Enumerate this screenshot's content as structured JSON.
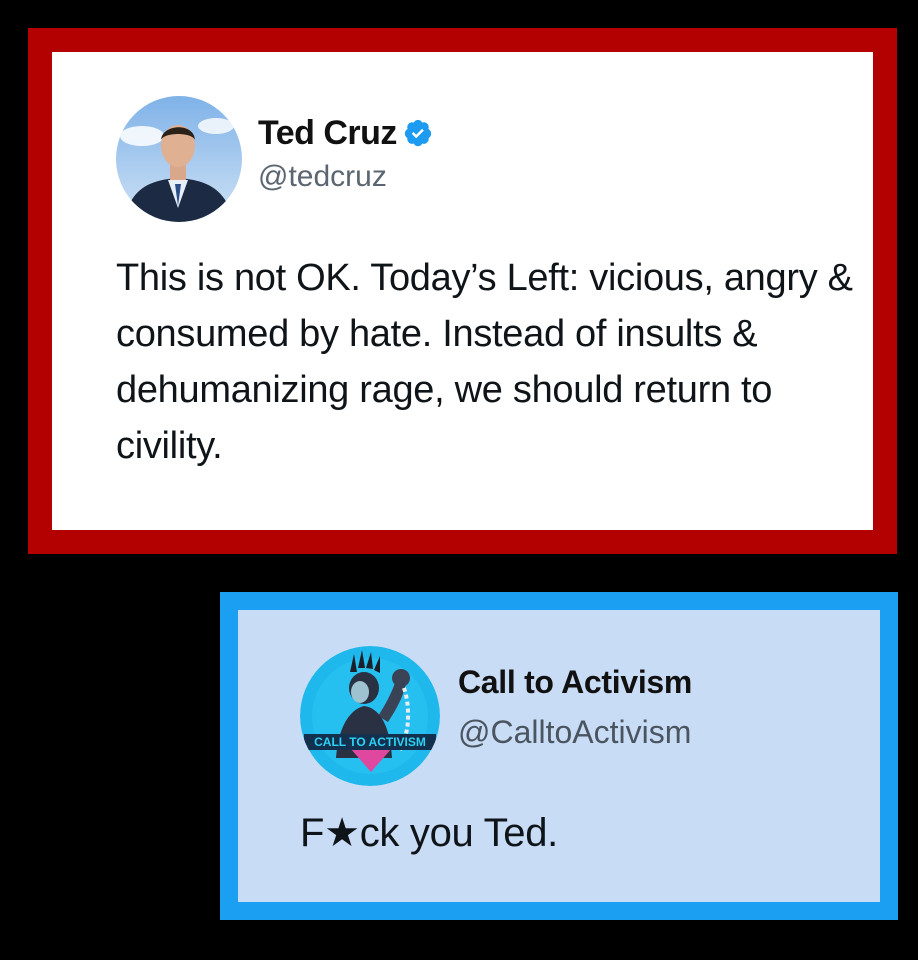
{
  "tweet1": {
    "author_name": "Ted Cruz",
    "handle": "@tedcruz",
    "text": "This is not OK. Today’s Left: vicious, angry & consumed by hate. Instead of insults & dehumanizing rage, we should return to civility.",
    "verified_icon": "verified-badge-icon",
    "frame_color": "#b30000"
  },
  "tweet2": {
    "author_name": "Call to Activism",
    "handle": "@CalltoActivism",
    "text": "F★ck you Ted.",
    "avatar_logo_text": "CALL TO ACTIVISM",
    "frame_color": "#1a9ff2",
    "card_color": "#c9dcf5"
  }
}
